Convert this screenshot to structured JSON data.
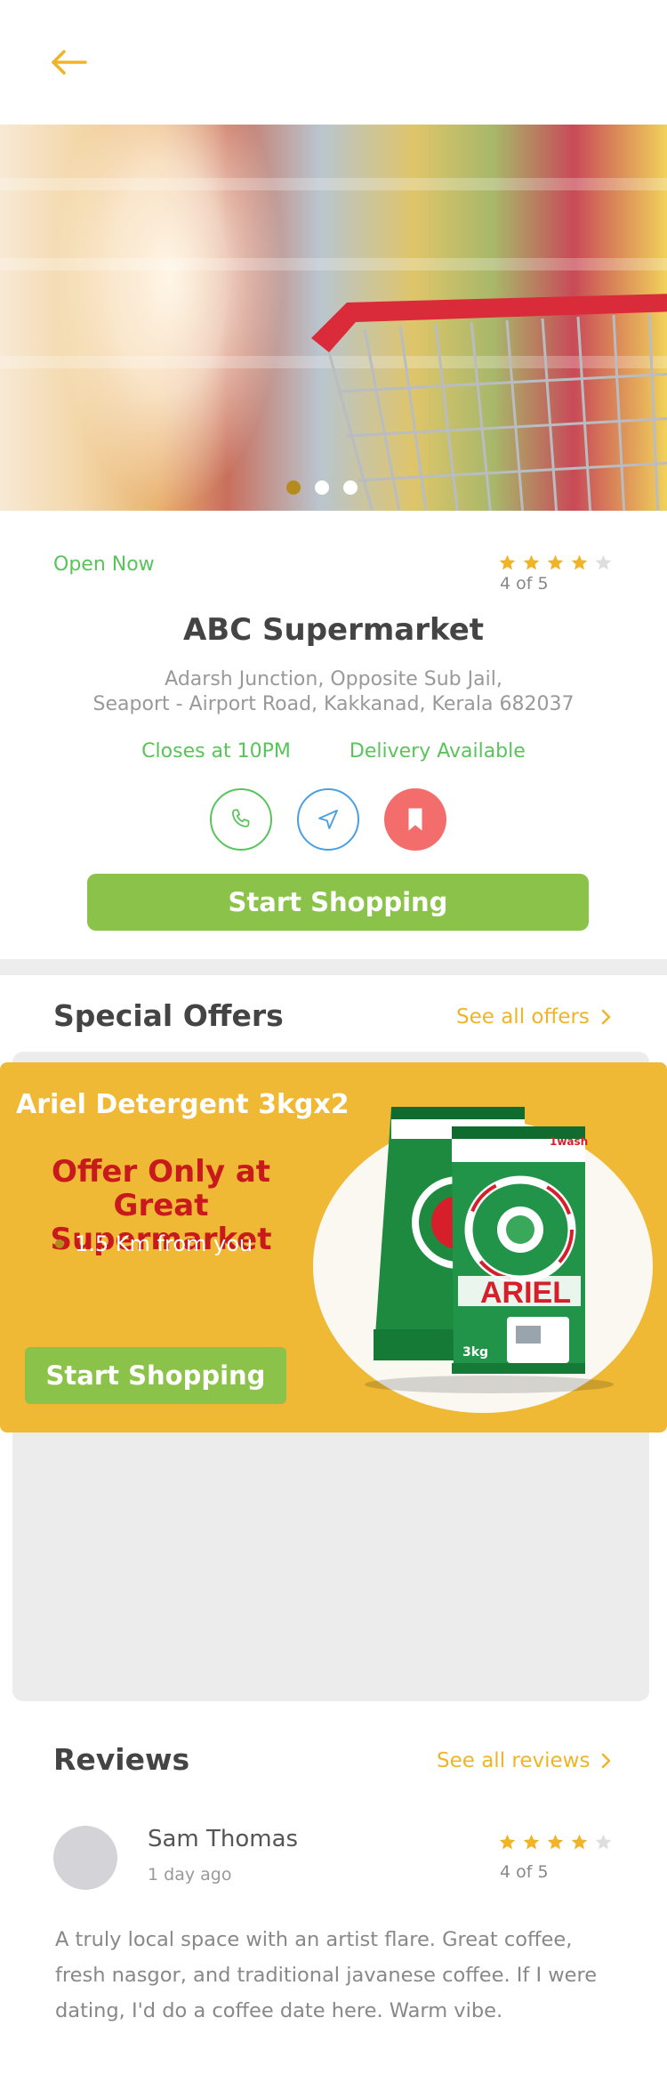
{
  "header": {
    "back_icon": "arrow-left-icon"
  },
  "hero": {
    "slides": 3,
    "active_slide": 1
  },
  "store": {
    "status": "Open Now",
    "rating": 4,
    "rating_max": 5,
    "rating_text": "4 of 5",
    "name": "ABC Supermarket",
    "address_line1": "Adarsh Junction, Opposite Sub Jail,",
    "address_line2": "Seaport - Airport Road, Kakkanad, Kerala 682037",
    "closes": "Closes at 10PM",
    "delivery": "Delivery Available",
    "actions": [
      "phone-icon",
      "navigation-icon",
      "bookmark-icon"
    ],
    "shop_button": "Start Shopping"
  },
  "offers": {
    "title": "Special Offers",
    "see_all": "See all offers",
    "card": {
      "product": "Ariel Detergent 3kgx2",
      "headline_line1": "Offer Only at",
      "headline_line2": "Great Supermarket",
      "distance": "1.5 Km from you",
      "button": "Start Shopping",
      "pack_brand": "ARIEL",
      "pack_weight": "3kg",
      "pack_tag": "1wash"
    }
  },
  "reviews": {
    "title": "Reviews",
    "see_all": "See all reviews",
    "items": [
      {
        "name": "Sam Thomas",
        "time": "1 day ago",
        "rating": 4,
        "rating_text": "4 of 5",
        "text": "A truly local space with an artist flare. Great coffee, fresh nasgor, and traditional javanese coffee. If I were dating, I'd do a coffee date here. Warm vibe."
      }
    ]
  },
  "colors": {
    "accent": "#f0b429",
    "green": "#58c45a",
    "button_green": "#8bc34a",
    "offer_bg": "#efb936",
    "offer_red": "#c8191c",
    "bookmark_red": "#f36d6d",
    "nav_blue": "#4a9fe0"
  }
}
